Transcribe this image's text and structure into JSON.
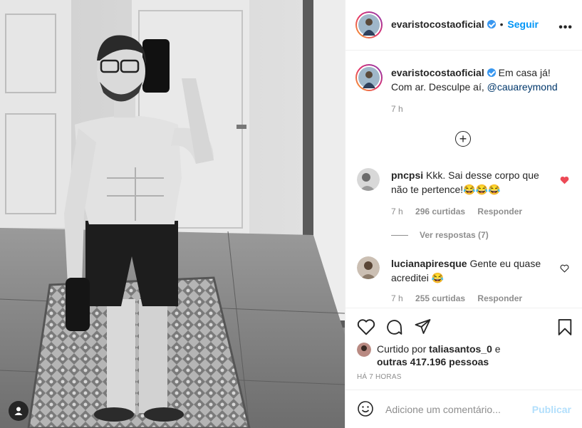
{
  "post": {
    "author": "evaristocostaoficial",
    "follow_label": "Seguir",
    "more_label": "•••",
    "caption": "Em casa já! Com ar. Desculpe aí,",
    "caption_mention": "@cauareymond",
    "caption_time": "7 h"
  },
  "load_more_label": "+",
  "comments": [
    {
      "user": "pncpsi",
      "text": "Kkk. Sai desse corpo que não te pertence!😂😂😂",
      "time": "7 h",
      "likes": "296 curtidas",
      "reply": "Responder",
      "view_replies": "Ver respostas (7)",
      "liked": true
    },
    {
      "user": "lucianapiresque",
      "text": "Gente eu quase acreditei 😂",
      "time": "7 h",
      "likes": "255 curtidas",
      "reply": "Responder",
      "liked": false
    }
  ],
  "likes": {
    "prefix": "Curtido por",
    "user": "taliasantos_0",
    "joiner": "e",
    "others": "outras 417.196 pessoas"
  },
  "timestamp": "HÁ 7 HORAS",
  "add_comment": {
    "placeholder": "Adicione um comentário...",
    "publish_label": "Publicar"
  },
  "colors": {
    "accent": "#0095f6",
    "liked_heart": "#ed4956",
    "publish_disabled": "#b2dffc",
    "verified": "#3897f0"
  }
}
